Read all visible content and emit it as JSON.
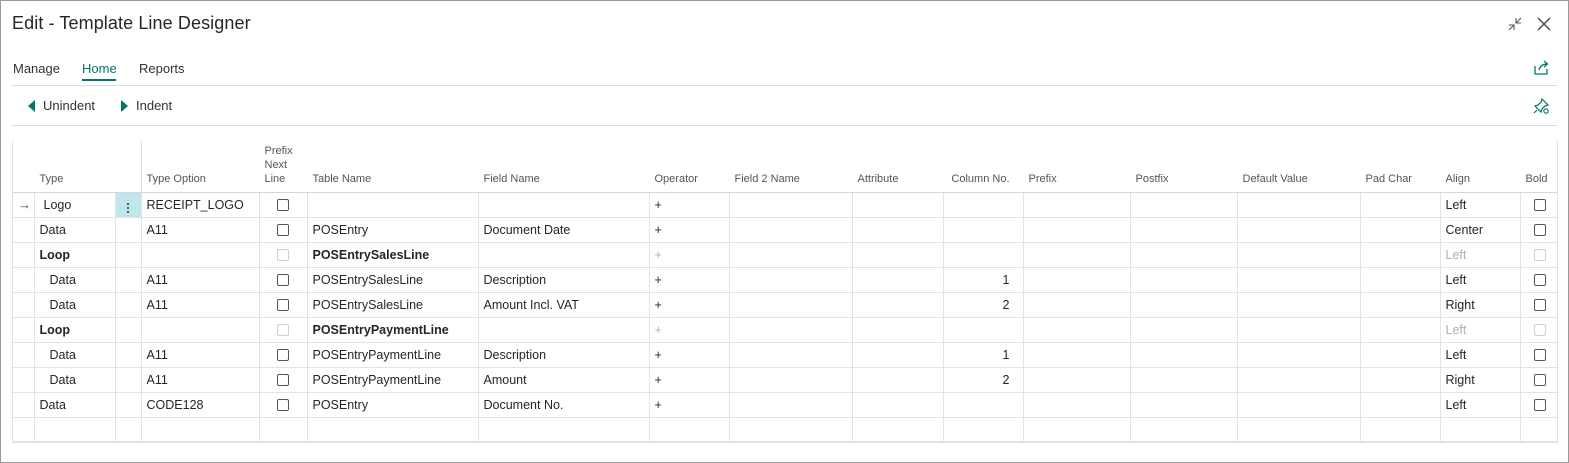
{
  "window": {
    "title": "Edit - Template Line Designer"
  },
  "tabs": [
    {
      "label": "Manage",
      "active": false
    },
    {
      "label": "Home",
      "active": true
    },
    {
      "label": "Reports",
      "active": false
    }
  ],
  "actions": {
    "unindent": "Unindent",
    "indent": "Indent"
  },
  "icons": {
    "collapse": "collapse-icon",
    "close": "close-icon",
    "share": "share-icon",
    "personalize": "pin-settings-icon"
  },
  "colors": {
    "accent": "#00766e",
    "selected_cell": "#bfe6ea"
  },
  "grid": {
    "columns": {
      "type": "Type",
      "type_option": "Type Option",
      "prefix_next_line_1": "Prefix",
      "prefix_next_line_2": "Next",
      "prefix_next_line_3": "Line",
      "table_name": "Table Name",
      "field_name": "Field Name",
      "operator": "Operator",
      "field2_name": "Field 2 Name",
      "attribute": "Attribute",
      "column_no": "Column No.",
      "prefix": "Prefix",
      "postfix": "Postfix",
      "default_value": "Default Value",
      "pad_char": "Pad Char",
      "align": "Align",
      "bold": "Bold"
    },
    "rows": [
      {
        "type": "Logo",
        "type_option": "RECEIPT_LOGO",
        "table_name": "",
        "field_name": "",
        "operator": "+",
        "column_no": "",
        "align": "Left"
      },
      {
        "type": "Data",
        "type_option": "A11",
        "table_name": "POSEntry",
        "field_name": "Document Date",
        "operator": "+",
        "column_no": "",
        "align": "Center"
      },
      {
        "type": "Loop",
        "type_option": "",
        "table_name": "POSEntrySalesLine",
        "field_name": "",
        "operator": "+",
        "column_no": "",
        "align": "Left"
      },
      {
        "type": "Data",
        "type_option": "A11",
        "table_name": "POSEntrySalesLine",
        "field_name": "Description",
        "operator": "+",
        "column_no": "1",
        "align": "Left"
      },
      {
        "type": "Data",
        "type_option": "A11",
        "table_name": "POSEntrySalesLine",
        "field_name": "Amount Incl. VAT",
        "operator": "+",
        "column_no": "2",
        "align": "Right"
      },
      {
        "type": "Loop",
        "type_option": "",
        "table_name": "POSEntryPaymentLine",
        "field_name": "",
        "operator": "+",
        "column_no": "",
        "align": "Left"
      },
      {
        "type": "Data",
        "type_option": "A11",
        "table_name": "POSEntryPaymentLine",
        "field_name": "Description",
        "operator": "+",
        "column_no": "1",
        "align": "Left"
      },
      {
        "type": "Data",
        "type_option": "A11",
        "table_name": "POSEntryPaymentLine",
        "field_name": "Amount",
        "operator": "+",
        "column_no": "2",
        "align": "Right"
      },
      {
        "type": "Data",
        "type_option": "CODE128",
        "table_name": "POSEntry",
        "field_name": "Document No.",
        "operator": "+",
        "column_no": "",
        "align": "Left"
      }
    ]
  }
}
